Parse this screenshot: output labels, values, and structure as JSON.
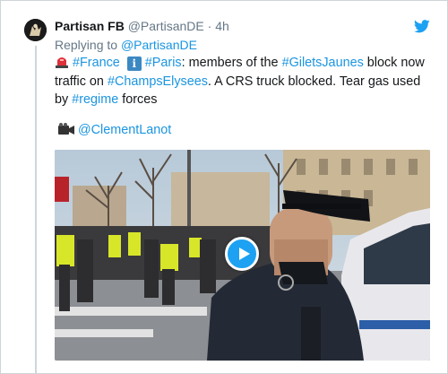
{
  "tweet": {
    "author_name": "Partisan FB",
    "author_handle": "@PartisanDE",
    "separator": "·",
    "time": "4h",
    "reply_prefix": "Replying to",
    "reply_to": "@PartisanDE",
    "hashtag_france": "#France",
    "hashtag_paris": "#Paris",
    "text_part1": ": members of the ",
    "hashtag_gilets": "#GiletsJaunes",
    "text_part2": " block now traffic on ",
    "hashtag_champs": "#ChampsElysees",
    "text_part3": ". A CRS truck blocked. Tear gas used by ",
    "hashtag_regime": "#regime",
    "text_part4": " forces",
    "video_credit": "@ClementLanot"
  },
  "colors": {
    "link": "#1b95e0",
    "muted": "#657786",
    "play_button": "#1da1f2"
  },
  "icons": [
    "avatar",
    "twitter-bird-icon",
    "police-siren-icon",
    "information-icon",
    "video-camera-icon",
    "play-icon"
  ]
}
